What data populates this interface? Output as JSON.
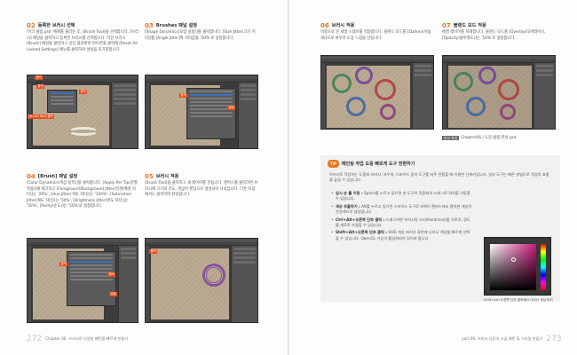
{
  "left_page": {
    "steps": [
      {
        "num": "02",
        "title": "등록한 브러시 선택",
        "text": "'마크 클럽.psd' 예제를 불러온 후, [Brush Tool]을 선택합니다. [브러시] 패널을 클릭하고 등록한 브러시를 선택합니다. 이전 브러시 [Brush] 패널을 클릭하고 상단 옵션바의 아이콘을 클릭해 [Reset All Locked Settings] 메뉴를 클릭하여 설정을 초기화합니다.",
        "callouts": [
          "클릭",
          "클릭",
          "클릭",
          "[Brush Tool] 클릭"
        ]
      },
      {
        "num": "03",
        "title": "Brushes 패널 설정",
        "text": "[Shape Dynamics(모양 설정)]를 클릭합니다. [Size Jitter(크기 지터)]를 [Angle Jitter]와 지터값을 '50%'로 설정합니다.",
        "callouts": [
          "클릭",
          "설정"
        ]
      },
      {
        "num": "04",
        "title": "[Brush] 패널 설정",
        "text": "[Color Dynamics(색상 동적)]을 클릭합니다. [Apply Per Tip(끝별 적용)]에 체크하고 [Foreground/Background Jitter(전경/배경 지터)]는 '20%', [Hue Jitter(색조 지터)]는 '100%', [Saturation Jitter(채도 지터)]는 '50%', [Brightness Jitter(명도 지터)]는 '50%', [Purity(순도)]는 '50%'로 설정합니다.",
        "callouts": [
          "클릭",
          "체크",
          "설정"
        ]
      },
      {
        "num": "05",
        "title": "브러시 적용",
        "text": "[Brush Tool]을 클릭하고 새 레이어를 만듭니다. 캔버스를 클릭하면 브러시에 크기와 각도, 색상이 랜덤으로 생성되어 나타납니다. 다른 지점에서도 클릭하여 완성합니다.",
        "callouts": [
          "클릭"
        ]
      }
    ],
    "footer": {
      "page": "272",
      "text": "Chapter 06. 브러시로 다양한 패턴을 빠르게 만들기"
    }
  },
  "right_page": {
    "steps": [
      {
        "num": "06",
        "title": "브러시 적용",
        "text": "이중으로 된 세밀 스탬프를 적용합니다. 블렌드 모드를 [Darken(어둡게)]으로 바꾸어 도장 느낌을 만듭니다.",
        "callouts": []
      },
      {
        "num": "07",
        "title": "블렌드 모드 적용",
        "text": "배경 레이어를 복제합니다. 블렌드 모드를 [Overlay(오버레이)], [Opacity(불투명도)]는 '50%'로 설정합니다.",
        "callouts": []
      }
    ],
    "caption": {
      "tag": "완성 파일",
      "text": "Chapter06 / 도장 클럽 완성.psd"
    },
    "tip": {
      "badge": "TIP",
      "title": "페인팅 작업 도중 빠르게 도구 전환하기",
      "intro": "브러시로 작업하는 도중에 브러시, 지우개, 스포이드 등의 도구를 자주 전환할 때 유용한 단축키입니다. 일부 도구는 빠른 방법으로 작업의 효율을 높일 수 있습니다.",
      "items": [
        {
          "label": "임시 손 툴 이동 :",
          "text": "Space를 누르고 있으면 손 도구로 전환되어 드래그로 화면을 이동할 수 있습니다."
        },
        {
          "label": "색상 추출하기 :",
          "text": "Alt를 누르고 있으면 스포이드 도구로 바뀌어 캔버스에서 클릭한 색상이 전경색으로 설정됩니다."
        },
        {
          "label": "Ctrl+Alt+오른쪽 단추 클릭 :",
          "text": "드래그하면 브러시의 크기(Hardness)를 가로로, 경도를 세로로 조절할 수 있습니다."
        },
        {
          "label": "Shift+Alt+오른쪽 단추 클릭 :",
          "text": "HUD 색상 피커가 화면에 나타나 색상을 빠르게 선택할 수 있습니다. OpenGL 기능이 활성화되어 있어야 합니다."
        }
      ],
      "hud_caption": "Shift+Alt+오른쪽 단추 클릭해서 나타난 색상 피커"
    },
    "footer": {
      "page": "273",
      "text": "part 06. 브러시 다루기 고급 패턴 및 스타일 만들기"
    }
  },
  "colors": {
    "accent": "#e8741f",
    "callout": "#e94e1b",
    "tip_bg": "#f1f1ef"
  }
}
